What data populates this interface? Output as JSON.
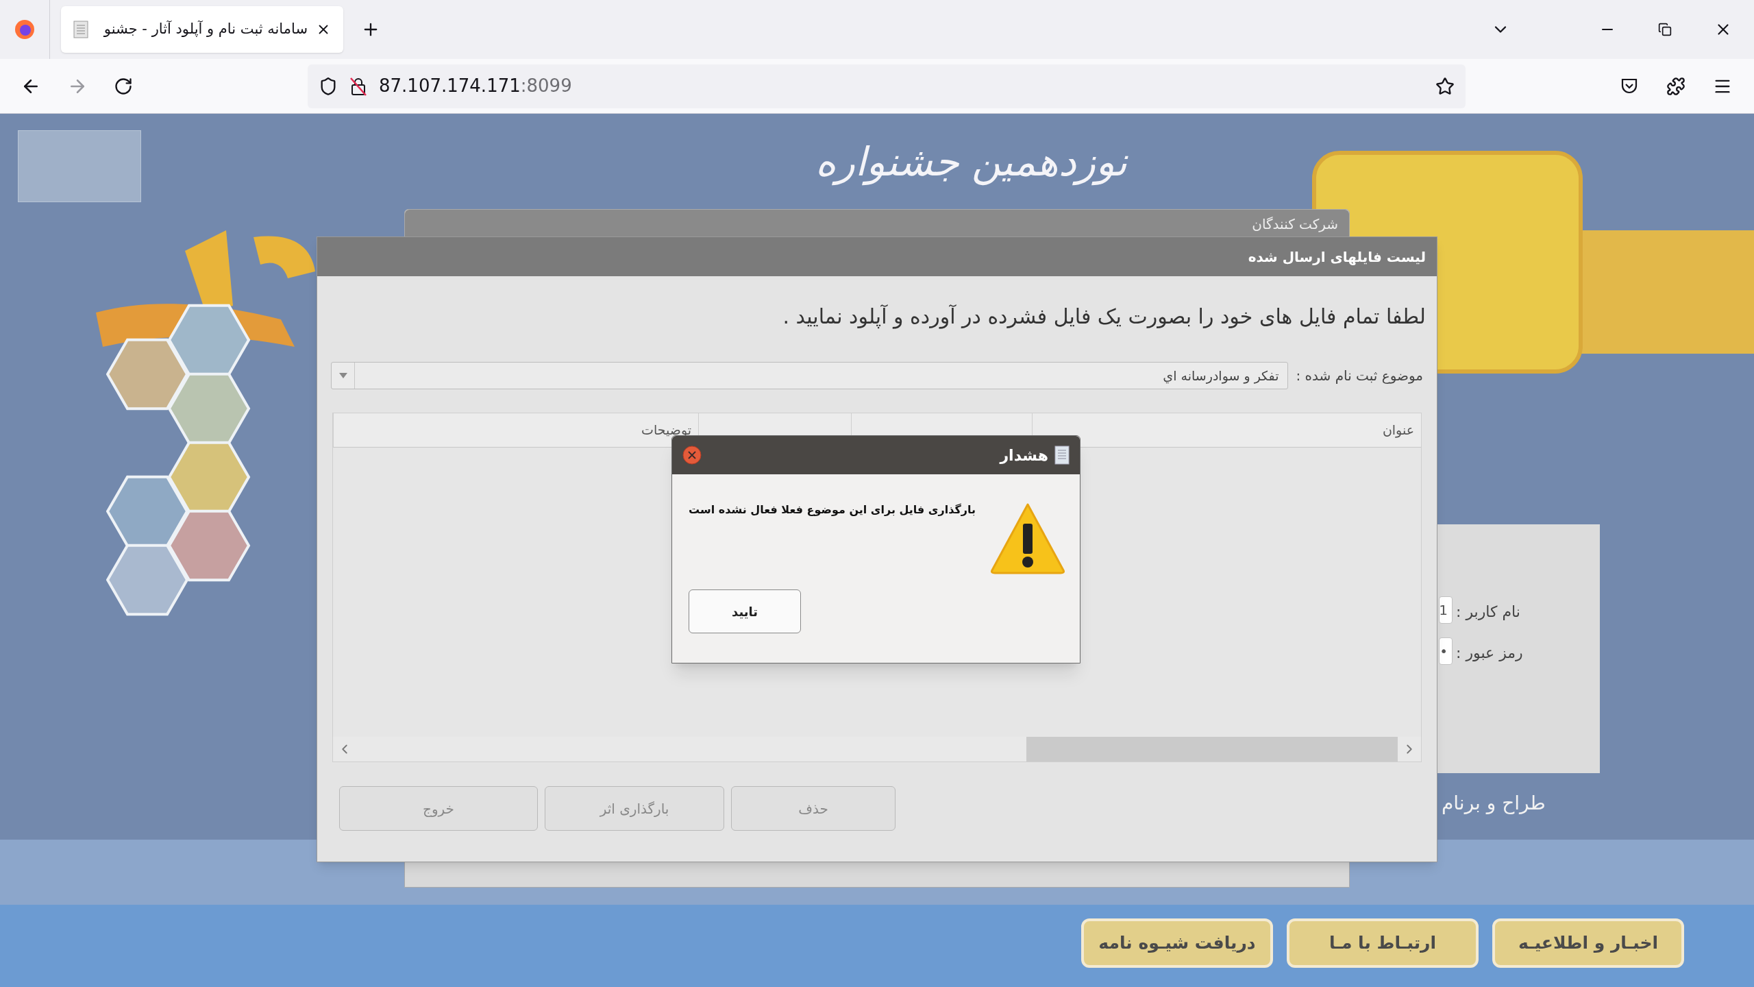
{
  "browser": {
    "tab_title": "سامانه ثبت نام و آپلود آثار - جشنو",
    "url_host": "87.107.174.171",
    "url_port": ":8099"
  },
  "page": {
    "festival_title": "نوزدهمین جشنواره",
    "background_dialog_title": "شرکت کنندگان",
    "login": {
      "username_label": "نام کاربر :",
      "username_value": "1",
      "password_label": "رمز عبور :",
      "password_value": "•"
    },
    "credit": "طراح و برنام",
    "nav_buttons": [
      "اخبـار و اطلاعیـه",
      "ارتبـاط با مـا",
      "دریافت شیـوه نامه"
    ]
  },
  "dialog": {
    "title": "لیست فایلهای ارسال شده",
    "instruction": "لطفا تمام فایل های خود را بصورت یک فایل فشرده در آورده و آپلود نمایید .",
    "topic_label": "موضوع ثبت نام شده :",
    "topic_value": "تفکر و سوادرسانه اي",
    "columns": [
      {
        "label": "عنوان"
      },
      {
        "label": "توضیحات"
      }
    ],
    "buttons": [
      "حذف",
      "بارگذاری اثر",
      "خروج"
    ]
  },
  "alert": {
    "title": "هشدار",
    "message": "بارگذاری فایل برای این موضوع فعلا فعال نشده است",
    "button": "تایید"
  }
}
